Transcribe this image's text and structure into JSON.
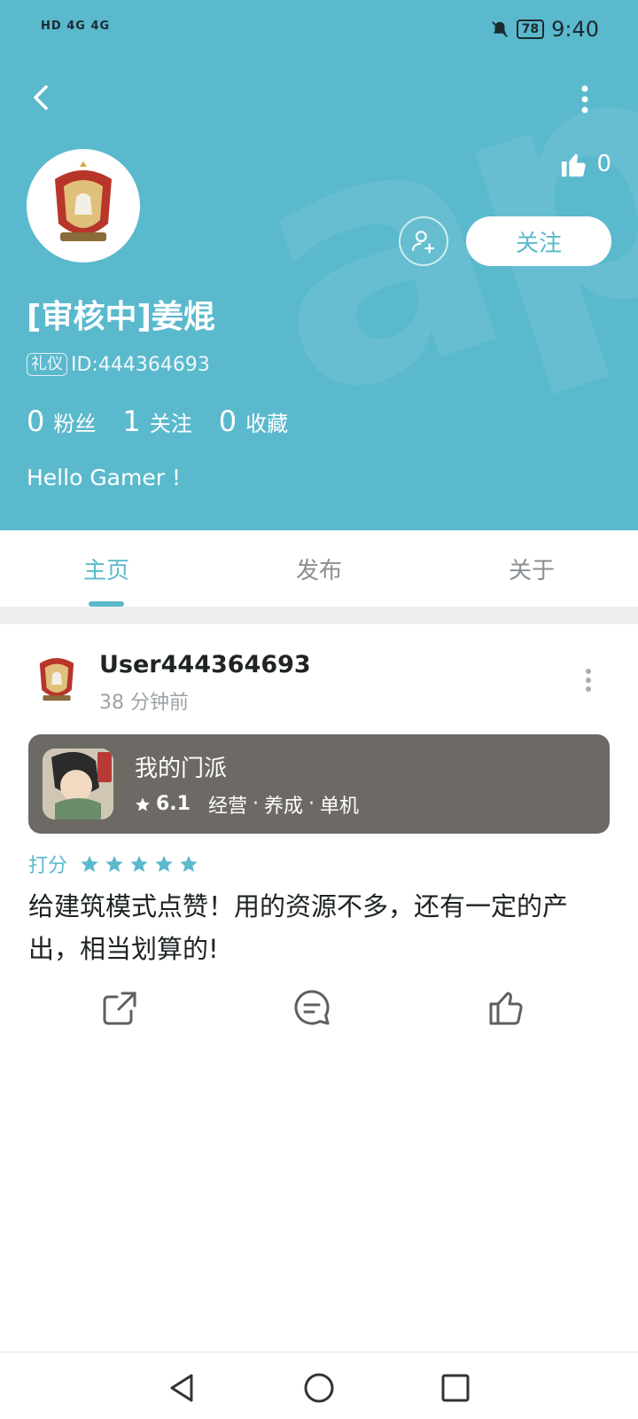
{
  "status_bar": {
    "signal_text": "HD 4G 4G",
    "battery": "78",
    "time": "9:40"
  },
  "profile": {
    "username": "[审核中]姜焜",
    "id_tag": "礼仪",
    "id_text": "ID:444364693",
    "likes": "0",
    "follow_label": "关注",
    "stats": [
      {
        "num": "0",
        "label": "粉丝"
      },
      {
        "num": "1",
        "label": "关注"
      },
      {
        "num": "0",
        "label": "收藏"
      }
    ],
    "bio": "Hello Gamer !"
  },
  "tabs": [
    {
      "label": "主页",
      "active": true
    },
    {
      "label": "发布",
      "active": false
    },
    {
      "label": "关于",
      "active": false
    }
  ],
  "post": {
    "user": "User444364693",
    "time": "38 分钟前",
    "game": {
      "name": "我的门派",
      "score": "6.1",
      "tags": [
        "经营",
        "养成",
        "单机"
      ]
    },
    "rating_label": "打分",
    "rating_stars": 5,
    "review": "给建筑模式点赞！用的资源不多，还有一定的产出，相当划算的!"
  },
  "colors": {
    "accent": "#5ab9cd",
    "card": "#6d6a66"
  }
}
